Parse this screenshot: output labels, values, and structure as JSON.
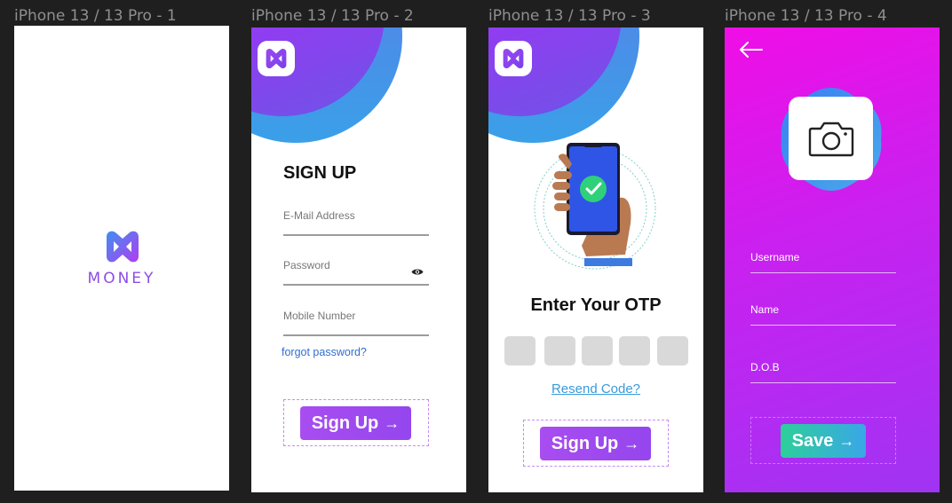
{
  "frames": [
    {
      "label": "iPhone 13 / 13 Pro - 1"
    },
    {
      "label": "iPhone 13 / 13 Pro - 2"
    },
    {
      "label": "iPhone 13 / 13 Pro - 3"
    },
    {
      "label": "iPhone 13 / 13 Pro - 4"
    }
  ],
  "splash": {
    "brand_word": "MONEY"
  },
  "signup": {
    "title": "SIGN UP",
    "email_placeholder": "E-Mail Address",
    "password_placeholder": "Password",
    "mobile_placeholder": "Mobile Number",
    "forgot_link": "forgot password?",
    "submit_label": "Sign Up",
    "submit_arrow": "→"
  },
  "otp": {
    "title": "Enter Your OTP",
    "box_count": 5,
    "resend_link": "Resend Code?",
    "submit_label": "Sign Up",
    "submit_arrow": "→"
  },
  "profile": {
    "username_placeholder": "Username",
    "name_placeholder": "Name",
    "dob_placeholder": "D.O.B",
    "save_label": "Save",
    "save_arrow": "→"
  },
  "icons": {
    "app_logo": "m-logo-icon",
    "eye": "eye-icon",
    "back": "back-arrow-icon",
    "camera": "camera-icon",
    "phone": "phone-check-icon"
  },
  "colors": {
    "brand_purple": "#9546ee",
    "brand_magenta": "#f00ee6",
    "brand_blue": "#3aa0e8",
    "link_blue": "#2f6fd1",
    "save_green": "#2dcf9a"
  }
}
